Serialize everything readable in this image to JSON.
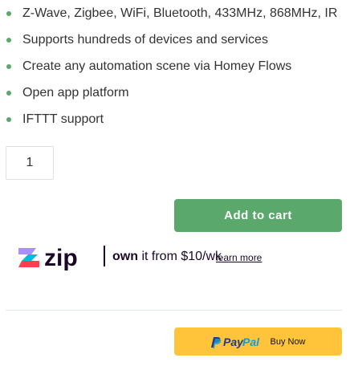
{
  "features": [
    "Z-Wave, Zigbee, WiFi, Bluetooth, 433MHz, 868MHz, IR",
    "Supports hundreds of devices and services",
    "Create any automation scene via Homey Flows",
    "Open app platform",
    "IFTTT support"
  ],
  "quantity": {
    "value": "1"
  },
  "cart": {
    "add_label": "Add to cart"
  },
  "zip": {
    "logo_text": "zip",
    "own_word": "own",
    "price_text": " it from $10/wk",
    "learn_more": "learn more"
  },
  "paypal": {
    "pay": "Pay",
    "pal": "Pal",
    "buy_now": "Buy Now"
  },
  "colors": {
    "accent_green": "#5aa86b",
    "paypal_yellow": "#ffc439",
    "paypal_dark_blue": "#253b80",
    "paypal_light_blue": "#179bd7",
    "zip_purple": "#1a0826",
    "zip_lavender": "#aa8fff",
    "zip_teal": "#00bcd4",
    "zip_red": "#ff3c50"
  }
}
